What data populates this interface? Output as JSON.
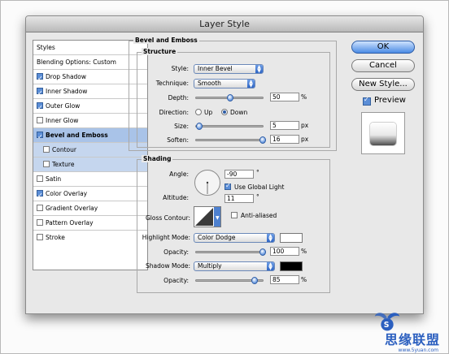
{
  "window": {
    "title": "Layer Style"
  },
  "left_panel": {
    "items": [
      {
        "label": "Styles",
        "checkbox": null
      },
      {
        "label": "Blending Options: Custom",
        "checkbox": null
      },
      {
        "label": "Drop Shadow",
        "checkbox": true
      },
      {
        "label": "Inner Shadow",
        "checkbox": true
      },
      {
        "label": "Outer Glow",
        "checkbox": true
      },
      {
        "label": "Inner Glow",
        "checkbox": false
      },
      {
        "label": "Bevel and Emboss",
        "checkbox": true,
        "selected": true
      },
      {
        "label": "Contour",
        "checkbox": false,
        "sub": true
      },
      {
        "label": "Texture",
        "checkbox": false,
        "sub": true
      },
      {
        "label": "Satin",
        "checkbox": false
      },
      {
        "label": "Color Overlay",
        "checkbox": true
      },
      {
        "label": "Gradient Overlay",
        "checkbox": false
      },
      {
        "label": "Pattern Overlay",
        "checkbox": false
      },
      {
        "label": "Stroke",
        "checkbox": false
      }
    ]
  },
  "bevel": {
    "section_title": "Bevel and Emboss",
    "structure_title": "Structure",
    "style_label": "Style:",
    "style_value": "Inner Bevel",
    "technique_label": "Technique:",
    "technique_value": "Smooth",
    "depth_label": "Depth:",
    "depth_value": "50",
    "depth_unit": "%",
    "direction_label": "Direction:",
    "direction_up": "Up",
    "direction_down": "Down",
    "direction_selected": "Down",
    "size_label": "Size:",
    "size_value": "5",
    "size_unit": "px",
    "soften_label": "Soften:",
    "soften_value": "16",
    "soften_unit": "px"
  },
  "shading": {
    "title": "Shading",
    "angle_label": "Angle:",
    "angle_value": "-90",
    "angle_unit": "°",
    "use_global_light": "Use Global Light",
    "use_global_light_checked": true,
    "altitude_label": "Altitude:",
    "altitude_value": "11",
    "altitude_unit": "°",
    "gloss_contour_label": "Gloss Contour:",
    "anti_aliased": "Anti-aliased",
    "anti_aliased_checked": false,
    "highlight_mode_label": "Highlight Mode:",
    "highlight_mode_value": "Color Dodge",
    "highlight_color": "#ffffff",
    "highlight_opacity_label": "Opacity:",
    "highlight_opacity_value": "100",
    "highlight_opacity_unit": "%",
    "shadow_mode_label": "Shadow Mode:",
    "shadow_mode_value": "Multiply",
    "shadow_color": "#000000",
    "shadow_opacity_label": "Opacity:",
    "shadow_opacity_value": "85",
    "shadow_opacity_unit": "%"
  },
  "buttons": {
    "ok": "OK",
    "cancel": "Cancel",
    "new_style": "New Style...",
    "preview": "Preview",
    "preview_checked": true
  },
  "watermark": {
    "text": "思缘联盟",
    "url": "www.5yuan.com"
  }
}
